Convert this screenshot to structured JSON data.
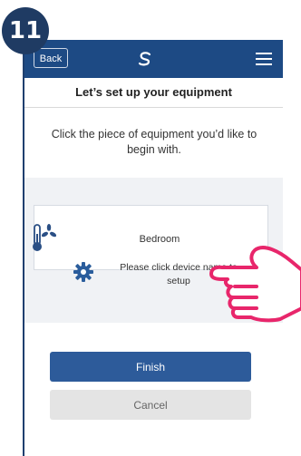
{
  "step": {
    "number": "11"
  },
  "appbar": {
    "back_label": "Back",
    "logo_icon": "salus-s-logo",
    "menu_icon": "hamburger-menu-icon"
  },
  "page": {
    "title": "Let’s set up your equipment",
    "instruction": "Click the piece of equipment you’d like to begin with."
  },
  "device": {
    "name": "Bedroom",
    "subtitle": "Please click device name to setup",
    "icons": [
      "thermostat-fan-icon",
      "gear-icon"
    ]
  },
  "actions": {
    "finish_label": "Finish",
    "cancel_label": "Cancel"
  },
  "overlay": {
    "pointer": "hand-pointer-icon"
  },
  "colors": {
    "header": "#1d4a84",
    "finish": "#2d5b9a",
    "cancel": "#e4e4e4",
    "badge": "#1f3b63",
    "hand": "#e8266b"
  }
}
